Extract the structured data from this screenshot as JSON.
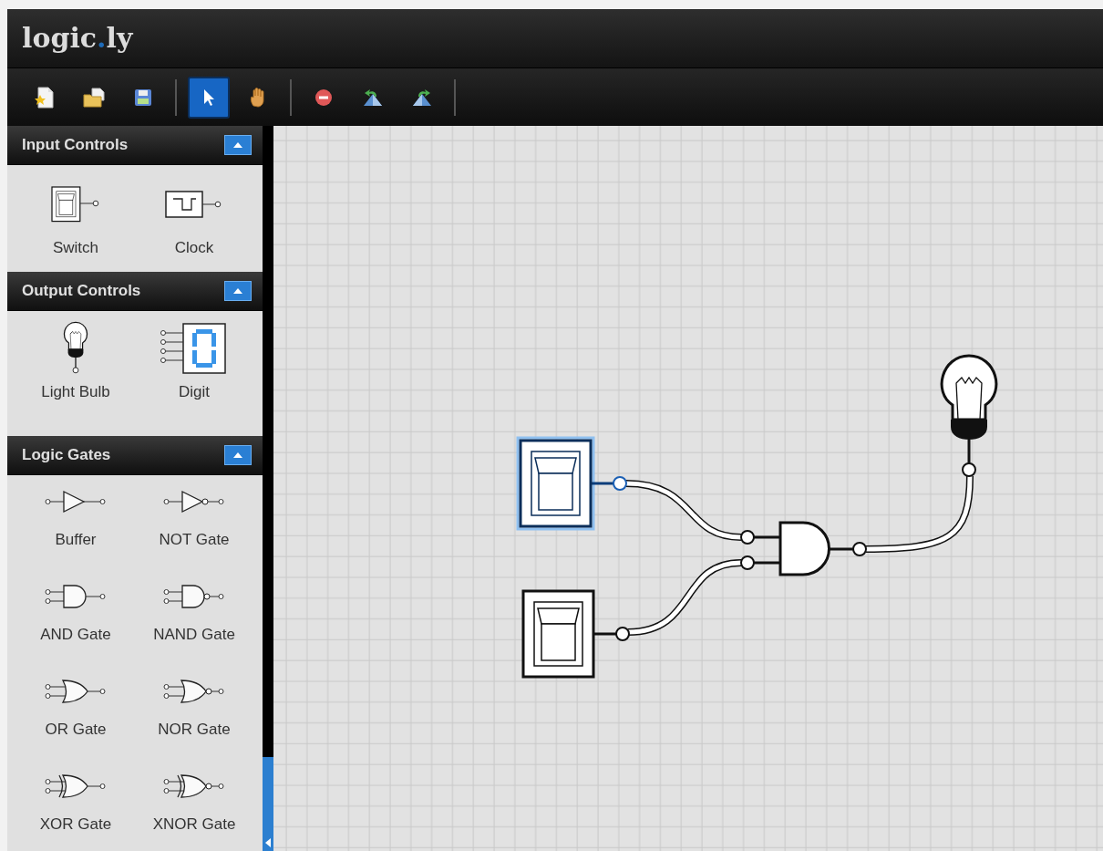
{
  "app": {
    "logo": [
      "logic",
      ".",
      "ly"
    ]
  },
  "toolbar": {
    "file_tools": [
      {
        "kind": "new"
      },
      {
        "kind": "open"
      },
      {
        "kind": "save"
      }
    ],
    "mode_tools": [
      {
        "kind": "select",
        "selected": true
      },
      {
        "kind": "pan",
        "selected": false
      }
    ],
    "edit_tools": [
      {
        "kind": "delete"
      },
      {
        "kind": "undo"
      },
      {
        "kind": "redo"
      }
    ]
  },
  "sidebar": {
    "sections": [
      {
        "title": "Input Controls",
        "expanded": true,
        "items": [
          {
            "label": "Switch",
            "kind": "switch"
          },
          {
            "label": "Clock",
            "kind": "clock"
          }
        ]
      },
      {
        "title": "Output Controls",
        "expanded": true,
        "items": [
          {
            "label": "Light Bulb",
            "kind": "light_bulb"
          },
          {
            "label": "Digit",
            "kind": "digit"
          }
        ]
      },
      {
        "title": "Logic Gates",
        "expanded": true,
        "items": [
          {
            "label": "Buffer",
            "kind": "buffer"
          },
          {
            "label": "NOT Gate",
            "kind": "not"
          },
          {
            "label": "AND Gate",
            "kind": "and"
          },
          {
            "label": "NAND Gate",
            "kind": "nand"
          },
          {
            "label": "OR Gate",
            "kind": "or"
          },
          {
            "label": "NOR Gate",
            "kind": "nor"
          },
          {
            "label": "XOR Gate",
            "kind": "xor"
          },
          {
            "label": "XNOR Gate",
            "kind": "xnor"
          }
        ]
      }
    ]
  },
  "canvas": {
    "components": [
      {
        "kind": "switch",
        "selected": true
      },
      {
        "kind": "switch",
        "selected": false
      },
      {
        "kind": "and_gate",
        "selected": false
      },
      {
        "kind": "light_bulb",
        "selected": false
      }
    ]
  }
}
